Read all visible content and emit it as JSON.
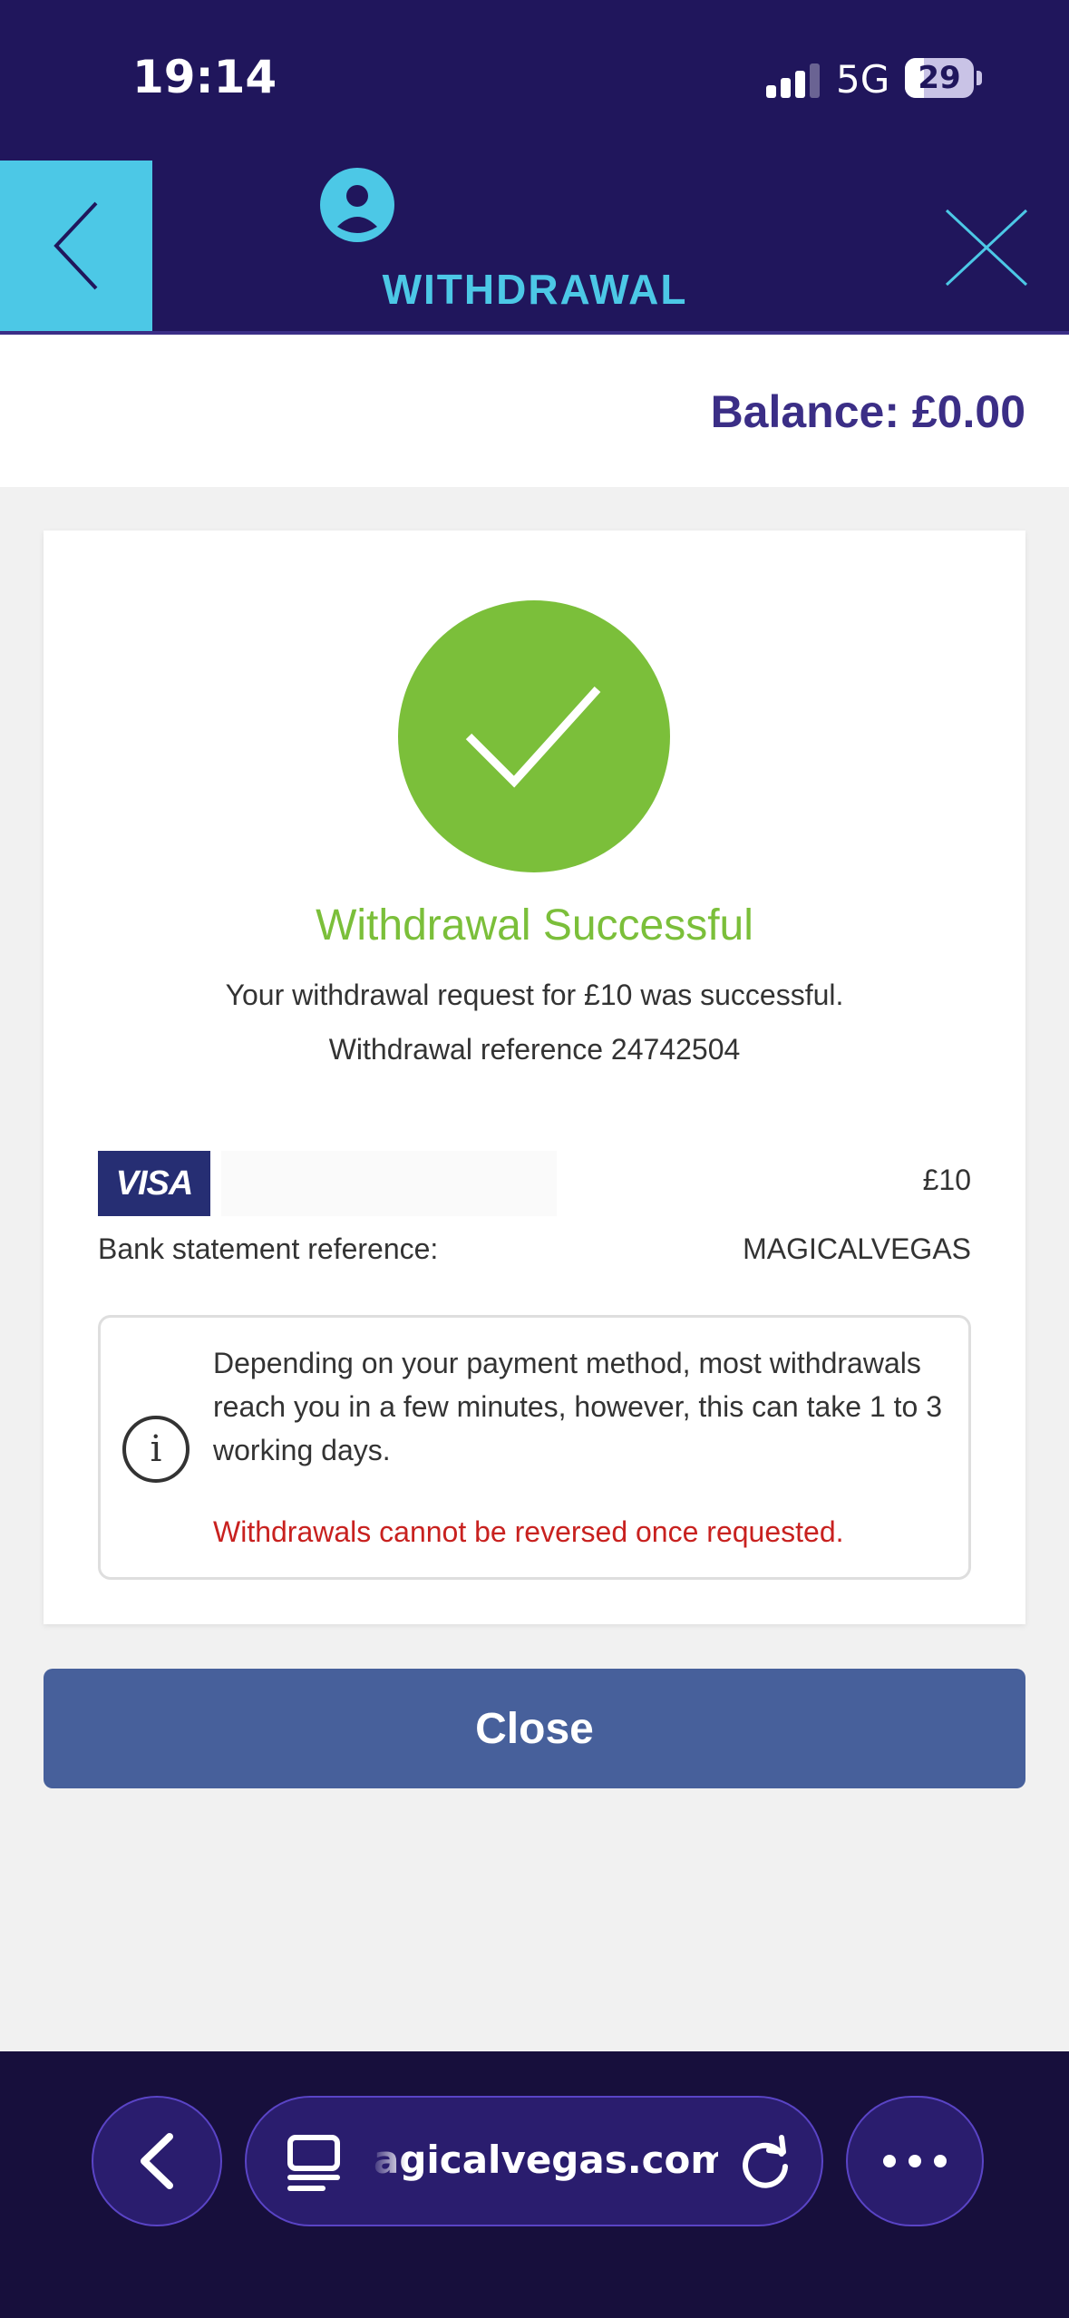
{
  "status_bar": {
    "time": "19:14",
    "network": "5G",
    "battery": "29",
    "signal_bars_filled": 3,
    "signal_bars_total": 4
  },
  "header": {
    "title": "WITHDRAWAL",
    "back_icon": "chevron-left-icon",
    "user_icon": "user-circle-icon",
    "close_icon": "close-icon"
  },
  "balance": {
    "label": "Balance: £0.00"
  },
  "result": {
    "icon": "checkmark-icon",
    "title": "Withdrawal Successful",
    "message": "Your withdrawal request for £10 was successful.",
    "reference": "Withdrawal reference 24742504"
  },
  "payment": {
    "method_logo": "VISA",
    "amount": "£10",
    "bank_ref_label": "Bank statement reference:",
    "bank_ref_value": "MAGICALVEGAS"
  },
  "info": {
    "icon": "info-icon",
    "text": "Depending on your payment method, most withdrawals reach you in a few minutes, however, this can take 1 to 3 working days.",
    "warning": "Withdrawals cannot be reversed once requested."
  },
  "actions": {
    "close_label": "Close"
  },
  "browser": {
    "url": "agicalvegas.com",
    "back_icon": "chevron-left-icon",
    "tabs_icon": "tabs-icon",
    "reload_icon": "reload-icon",
    "more_icon": "more-icon"
  },
  "colors": {
    "header_bg": "#20165c",
    "accent_cyan": "#4cc8e6",
    "success_green": "#7bbf3a",
    "warning_red": "#c8211f",
    "button_blue": "#47609b",
    "balance_purple": "#3b2e86"
  }
}
